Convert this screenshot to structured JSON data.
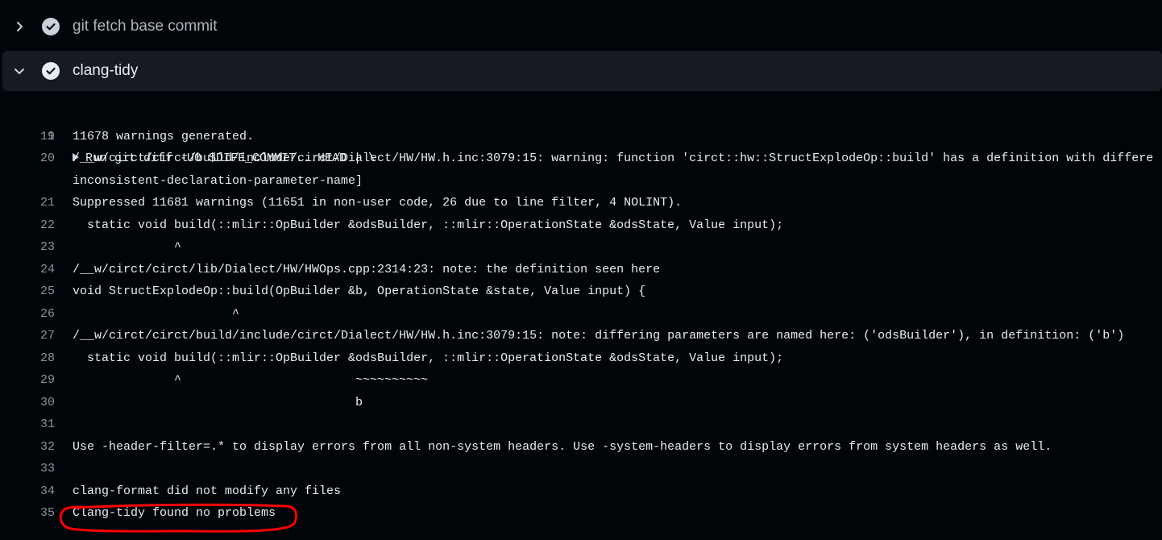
{
  "steps": [
    {
      "title": "git fetch base commit",
      "state": "collapsed",
      "status": "success"
    },
    {
      "title": "clang-tidy",
      "state": "expanded",
      "status": "success"
    }
  ],
  "colors": {
    "background": "#010409",
    "expanded_step_bg": "#161b22",
    "line_number": "#8b949e",
    "log_text": "#e6edf3",
    "annotation": "#ff0000"
  },
  "log": {
    "group_line": {
      "num": "1",
      "text": "Run git diff -U0 $DIFF_COMMIT...HEAD | \\"
    },
    "lines": [
      {
        "num": "19",
        "text": "11678 warnings generated."
      },
      {
        "num": "20",
        "text": "/__w/circt/circt/build/include/circt/Dialect/HW/HW.h.inc:3079:15: warning: function 'circt::hw::StructExplodeOp::build' has a definition with differe",
        "text2": "inconsistent-declaration-parameter-name]"
      },
      {
        "num": "21",
        "text": "Suppressed 11681 warnings (11651 in non-user code, 26 due to line filter, 4 NOLINT)."
      },
      {
        "num": "22",
        "text": "  static void build(::mlir::OpBuilder &odsBuilder, ::mlir::OperationState &odsState, Value input);"
      },
      {
        "num": "23",
        "text": "              ^"
      },
      {
        "num": "24",
        "text": "/__w/circt/circt/lib/Dialect/HW/HWOps.cpp:2314:23: note: the definition seen here"
      },
      {
        "num": "25",
        "text": "void StructExplodeOp::build(OpBuilder &b, OperationState &state, Value input) {"
      },
      {
        "num": "26",
        "text": "                      ^"
      },
      {
        "num": "27",
        "text": "/__w/circt/circt/build/include/circt/Dialect/HW/HW.h.inc:3079:15: note: differing parameters are named here: ('odsBuilder'), in definition: ('b')"
      },
      {
        "num": "28",
        "text": "  static void build(::mlir::OpBuilder &odsBuilder, ::mlir::OperationState &odsState, Value input);"
      },
      {
        "num": "29",
        "text": "              ^                        ~~~~~~~~~~"
      },
      {
        "num": "30",
        "text": "                                       b"
      },
      {
        "num": "31",
        "text": ""
      },
      {
        "num": "32",
        "text": "Use -header-filter=.* to display errors from all non-system headers. Use -system-headers to display errors from system headers as well."
      },
      {
        "num": "33",
        "text": ""
      },
      {
        "num": "34",
        "text": "clang-format did not modify any files"
      },
      {
        "num": "35",
        "text": "Clang-tidy found no problems"
      }
    ]
  }
}
